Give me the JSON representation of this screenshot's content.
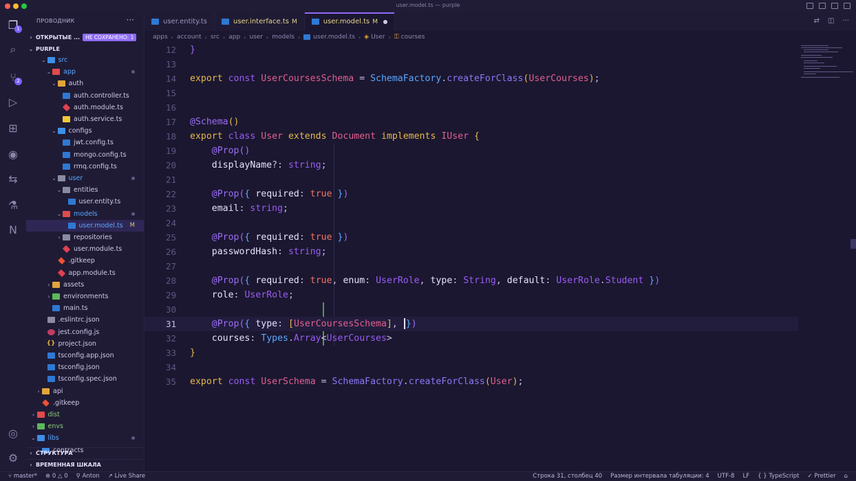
{
  "window": {
    "title": "user.model.ts — purple"
  },
  "activity": {
    "explorer_badge": "1",
    "scm_badge": "2"
  },
  "sidebar": {
    "title": "ПРОВОДНИК",
    "open_editors": "ОТКРЫТЫЕ ...",
    "unsaved_badge": "НЕ СОХРАНЕНО: 1",
    "project": "PURPLE",
    "tree": [
      {
        "name": "src",
        "depth": 3,
        "icon": "folder-blue",
        "twisty": "v",
        "color": "blue"
      },
      {
        "name": "app",
        "depth": 4,
        "icon": "folder-red",
        "twisty": "v",
        "color": "blue",
        "dot": true
      },
      {
        "name": "auth",
        "depth": 5,
        "icon": "folder",
        "twisty": "v"
      },
      {
        "name": "auth.controller.ts",
        "depth": 6,
        "icon": "ts"
      },
      {
        "name": "auth.module.ts",
        "depth": 6,
        "icon": "angular"
      },
      {
        "name": "auth.service.ts",
        "depth": 6,
        "icon": "yellow"
      },
      {
        "name": "configs",
        "depth": 5,
        "icon": "folder-blue",
        "twisty": "v"
      },
      {
        "name": "jwt.config.ts",
        "depth": 6,
        "icon": "ts"
      },
      {
        "name": "mongo.config.ts",
        "depth": 6,
        "icon": "ts"
      },
      {
        "name": "rmq.config.ts",
        "depth": 6,
        "icon": "ts"
      },
      {
        "name": "user",
        "depth": 5,
        "icon": "folder-grey",
        "twisty": "v",
        "color": "blue",
        "dot": true
      },
      {
        "name": "entities",
        "depth": 6,
        "icon": "folder-grey",
        "twisty": "v"
      },
      {
        "name": "user.entity.ts",
        "depth": 7,
        "icon": "ts"
      },
      {
        "name": "models",
        "depth": 6,
        "icon": "folder-red",
        "twisty": "v",
        "color": "blue",
        "dot": true
      },
      {
        "name": "user.model.ts",
        "depth": 7,
        "icon": "ts",
        "color": "blue",
        "mark": "M",
        "selected": true
      },
      {
        "name": "repositories",
        "depth": 6,
        "icon": "folder-grey",
        "twisty": ">"
      },
      {
        "name": "user.module.ts",
        "depth": 6,
        "icon": "angular"
      },
      {
        "name": ".gitkeep",
        "depth": 5,
        "icon": "git"
      },
      {
        "name": "app.module.ts",
        "depth": 5,
        "icon": "angular"
      },
      {
        "name": "assets",
        "depth": 4,
        "icon": "folder",
        "twisty": ">"
      },
      {
        "name": "environments",
        "depth": 4,
        "icon": "folder-green",
        "twisty": ">"
      },
      {
        "name": "main.ts",
        "depth": 4,
        "icon": "ts"
      },
      {
        "name": ".eslintrc.json",
        "depth": 3,
        "icon": "folder-grey"
      },
      {
        "name": "jest.config.js",
        "depth": 3,
        "icon": "jest"
      },
      {
        "name": "project.json",
        "depth": 3,
        "icon": "json"
      },
      {
        "name": "tsconfig.app.json",
        "depth": 3,
        "icon": "ts"
      },
      {
        "name": "tsconfig.json",
        "depth": 3,
        "icon": "ts"
      },
      {
        "name": "tsconfig.spec.json",
        "depth": 3,
        "icon": "ts"
      },
      {
        "name": "api",
        "depth": 2,
        "icon": "folder",
        "twisty": ">"
      },
      {
        "name": ".gitkeep",
        "depth": 2,
        "icon": "git"
      },
      {
        "name": "dist",
        "depth": 1,
        "icon": "folder-red",
        "twisty": ">",
        "color": "green"
      },
      {
        "name": "envs",
        "depth": 1,
        "icon": "folder-green",
        "twisty": ">",
        "color": "green"
      },
      {
        "name": "libs",
        "depth": 1,
        "icon": "folder-blue",
        "twisty": "v",
        "color": "blue",
        "dot": true
      },
      {
        "name": "contracts",
        "depth": 2,
        "icon": "folder-blue",
        "twisty": ">"
      }
    ],
    "structure": "СТРУКТУРА",
    "timeline": "ВРЕМЕННАЯ ШКАЛА"
  },
  "tabs": [
    {
      "label": "user.entity.ts",
      "mark": "",
      "active": false
    },
    {
      "label": "user.interface.ts",
      "mark": "M",
      "active": false
    },
    {
      "label": "user.model.ts",
      "mark": "M",
      "active": true
    }
  ],
  "breadcrumb": {
    "parts": [
      "apps",
      "account",
      "src",
      "app",
      "user",
      "models"
    ],
    "file": "user.model.ts",
    "class": "User",
    "member": "courses"
  },
  "editor": {
    "line_numbers": [
      "12",
      "13",
      "14",
      "15",
      "16",
      "17",
      "18",
      "19",
      "20",
      "21",
      "22",
      "23",
      "24",
      "25",
      "26",
      "27",
      "28",
      "29",
      "30",
      "31",
      "32",
      "33",
      "34",
      "35"
    ],
    "current_line": "31"
  },
  "status": {
    "branch": "master*",
    "errors": "0",
    "warnings": "0",
    "user": "Anton",
    "live_share": "Live Share",
    "position": "Строка 31, столбец 40",
    "indent": "Размер интервала табуляции: 4",
    "encoding": "UTF-8",
    "eol": "LF",
    "language": "TypeScript",
    "formatter": "Prettier"
  }
}
